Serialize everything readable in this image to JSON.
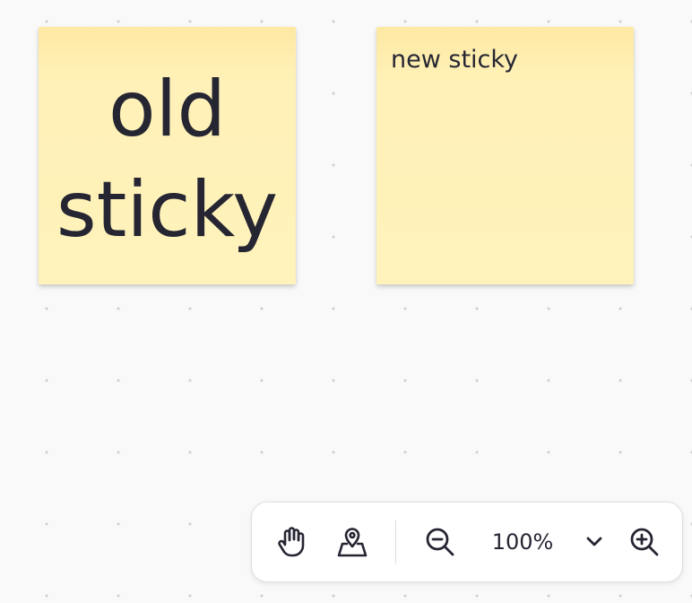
{
  "canvas": {
    "stickies": [
      {
        "text": "old sticky",
        "color": "#fff2ba"
      },
      {
        "text": "new sticky",
        "color": "#fff2ba"
      }
    ]
  },
  "toolbar": {
    "tools": [
      {
        "name": "hand-tool",
        "icon": "hand-icon"
      },
      {
        "name": "minimap-tool",
        "icon": "map-pin-icon"
      },
      {
        "name": "zoom-out",
        "icon": "zoom-out-icon"
      },
      {
        "name": "zoom-dropdown",
        "icon": "chevron-down-icon"
      },
      {
        "name": "zoom-in",
        "icon": "zoom-in-icon"
      }
    ],
    "zoom_level": "100%"
  }
}
